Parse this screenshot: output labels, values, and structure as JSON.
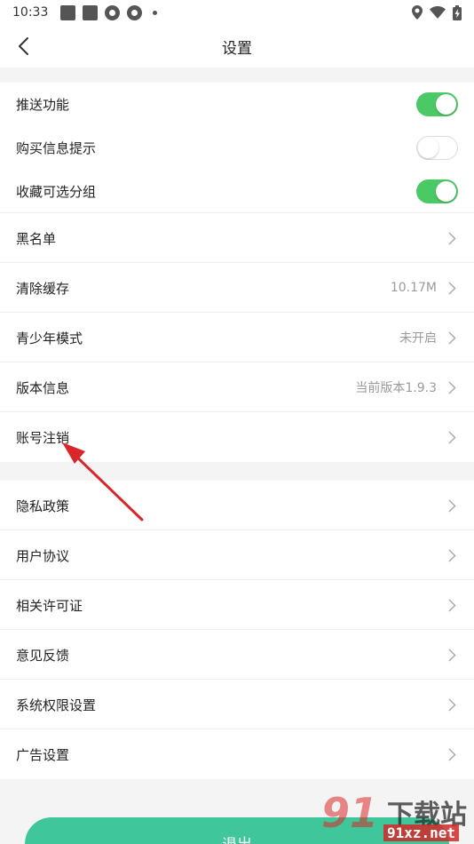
{
  "status_bar": {
    "time": "10:33"
  },
  "header": {
    "title": "设置"
  },
  "toggles": [
    {
      "label": "推送功能",
      "state": "on"
    },
    {
      "label": "购买信息提示",
      "state": "off"
    },
    {
      "label": "收藏可选分组",
      "state": "on"
    }
  ],
  "settings": [
    {
      "label": "黑名单",
      "value": ""
    },
    {
      "label": "清除缓存",
      "value": "10.17M"
    },
    {
      "label": "青少年模式",
      "value": "未开启"
    },
    {
      "label": "版本信息",
      "value": "当前版本1.9.3"
    },
    {
      "label": "账号注销",
      "value": ""
    }
  ],
  "links": [
    {
      "label": "隐私政策"
    },
    {
      "label": "用户协议"
    },
    {
      "label": "相关许可证"
    },
    {
      "label": "意见反馈"
    },
    {
      "label": "系统权限设置"
    },
    {
      "label": "广告设置"
    }
  ],
  "logout": {
    "label": "退出"
  },
  "watermark": {
    "logo": "91",
    "title": "下载站",
    "url": "91xz.net"
  },
  "colors": {
    "toggle_on": "#4bc964",
    "logout_button": "#3fc69a",
    "annotation_arrow": "#d9262b"
  }
}
